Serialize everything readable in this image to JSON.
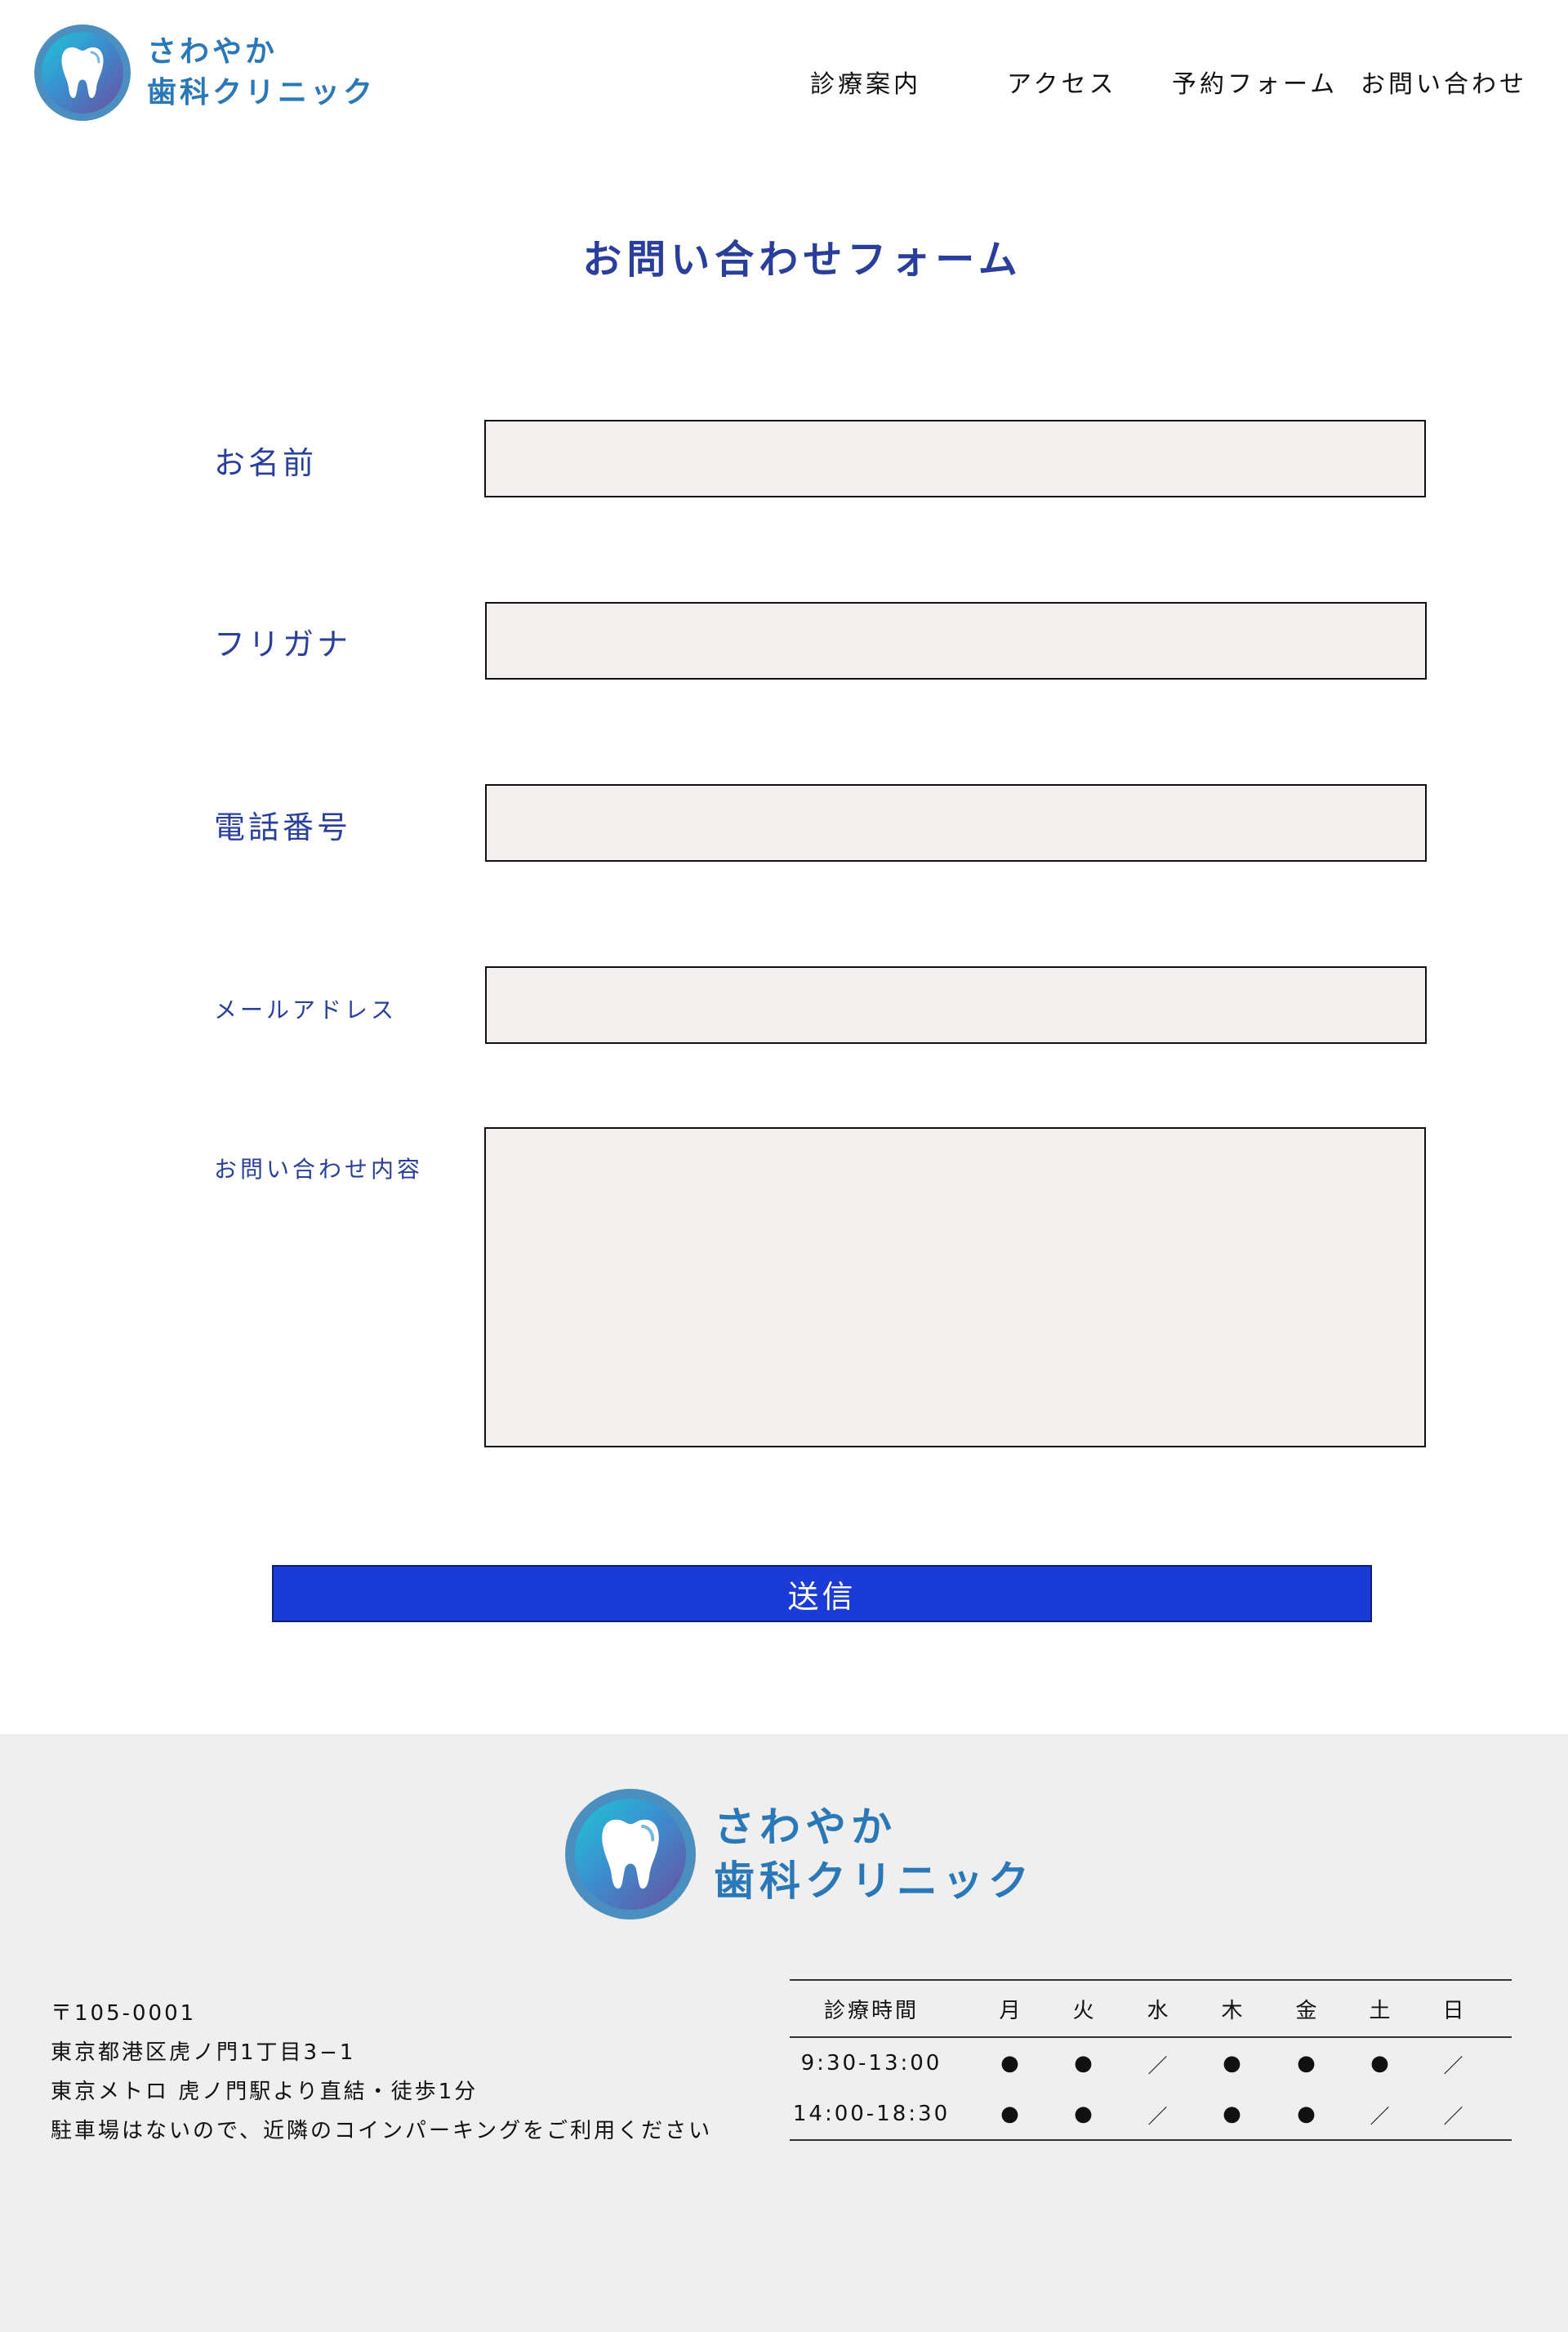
{
  "header": {
    "logo": {
      "line1": "さわやか",
      "line2": "歯科クリニック",
      "icon": "tooth-icon"
    },
    "nav": [
      "診療案内",
      "アクセス",
      "予約フォーム",
      "お問い合わせ"
    ]
  },
  "form": {
    "title": "お問い合わせフォーム",
    "fields": [
      {
        "label": "お名前",
        "value": "",
        "placeholder": ""
      },
      {
        "label": "フリガナ",
        "value": "",
        "placeholder": ""
      },
      {
        "label": "電話番号",
        "value": "",
        "placeholder": ""
      },
      {
        "label": "メールアドレス",
        "value": "",
        "placeholder": ""
      },
      {
        "label": "お問い合わせ内容",
        "value": "",
        "placeholder": ""
      }
    ],
    "submit_label": "送信"
  },
  "footer": {
    "logo": {
      "line1": "さわやか",
      "line2": "歯科クリニック",
      "icon": "tooth-icon"
    },
    "address": [
      "〒105-0001",
      "東京都港区虎ノ門1丁目3−1",
      "東京メトロ 虎ノ門駅より直結・徒歩1分",
      "駐車場はないので、近隣のコインパーキングをご利用ください"
    ],
    "hours": {
      "header": [
        "診療時間",
        "月",
        "火",
        "水",
        "木",
        "金",
        "土",
        "日"
      ],
      "rows": [
        {
          "time": "9:30-13:00",
          "marks": [
            "●",
            "●",
            "／",
            "●",
            "●",
            "●",
            "／"
          ]
        },
        {
          "time": "14:00-18:30",
          "marks": [
            "●",
            "●",
            "／",
            "●",
            "●",
            "／",
            "／"
          ]
        }
      ]
    }
  },
  "colors": {
    "accent_text": "#2a3f9a",
    "logo_text": "#2a78b8",
    "submit_bg": "#1b3bd6",
    "field_bg": "#f3f0ef",
    "footer_bg": "#efefef"
  }
}
